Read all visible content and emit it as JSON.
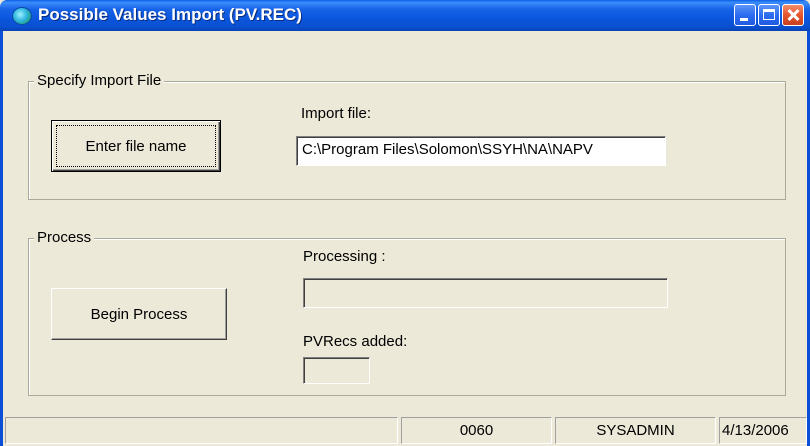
{
  "window": {
    "title": "Possible Values Import (PV.REC)",
    "icon": "app-icon",
    "title_bar_color": "#0a54d8",
    "close_color": "#e5542c"
  },
  "import_group": {
    "title": "Specify Import File",
    "enter_button_label": "Enter file name",
    "import_file_label": "Import file:",
    "import_file_value": "C:\\Program Files\\Solomon\\SSYH\\NA\\NAPV"
  },
  "process_group": {
    "title": "Process",
    "begin_button_label": "Begin Process",
    "processing_label": "Processing :",
    "processing_value": "",
    "pvrecs_label": "PVRecs added:",
    "pvrecs_value": ""
  },
  "statusbar": {
    "panel0": "",
    "panel1": "0060",
    "panel2": "SYSADMIN",
    "panel3": "4/13/2006"
  }
}
